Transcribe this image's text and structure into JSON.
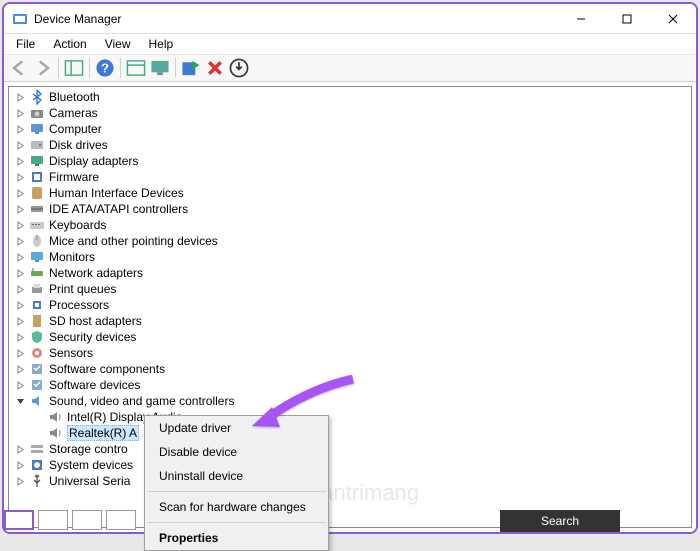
{
  "titlebar": {
    "title": "Device Manager"
  },
  "menubar": {
    "items": [
      "File",
      "Action",
      "View",
      "Help"
    ]
  },
  "toolbar": {
    "icons": [
      "back",
      "forward",
      "sep",
      "show-hide",
      "sep",
      "help",
      "sep",
      "columns",
      "monitor-check",
      "sep",
      "scan",
      "red-x",
      "circle-arrow"
    ]
  },
  "tree": {
    "items": [
      {
        "label": "Bluetooth",
        "level": 0,
        "expand": "right",
        "icon": "bluetooth"
      },
      {
        "label": "Cameras",
        "level": 0,
        "expand": "right",
        "icon": "camera"
      },
      {
        "label": "Computer",
        "level": 0,
        "expand": "right",
        "icon": "computer"
      },
      {
        "label": "Disk drives",
        "level": 0,
        "expand": "right",
        "icon": "disk"
      },
      {
        "label": "Display adapters",
        "level": 0,
        "expand": "right",
        "icon": "display"
      },
      {
        "label": "Firmware",
        "level": 0,
        "expand": "right",
        "icon": "firmware"
      },
      {
        "label": "Human Interface Devices",
        "level": 0,
        "expand": "right",
        "icon": "hid"
      },
      {
        "label": "IDE ATA/ATAPI controllers",
        "level": 0,
        "expand": "right",
        "icon": "ide"
      },
      {
        "label": "Keyboards",
        "level": 0,
        "expand": "right",
        "icon": "keyboard"
      },
      {
        "label": "Mice and other pointing devices",
        "level": 0,
        "expand": "right",
        "icon": "mouse"
      },
      {
        "label": "Monitors",
        "level": 0,
        "expand": "right",
        "icon": "monitor"
      },
      {
        "label": "Network adapters",
        "level": 0,
        "expand": "right",
        "icon": "network"
      },
      {
        "label": "Print queues",
        "level": 0,
        "expand": "right",
        "icon": "print"
      },
      {
        "label": "Processors",
        "level": 0,
        "expand": "right",
        "icon": "cpu"
      },
      {
        "label": "SD host adapters",
        "level": 0,
        "expand": "right",
        "icon": "sd"
      },
      {
        "label": "Security devices",
        "level": 0,
        "expand": "right",
        "icon": "security"
      },
      {
        "label": "Sensors",
        "level": 0,
        "expand": "right",
        "icon": "sensor"
      },
      {
        "label": "Software components",
        "level": 0,
        "expand": "right",
        "icon": "software"
      },
      {
        "label": "Software devices",
        "level": 0,
        "expand": "right",
        "icon": "software"
      },
      {
        "label": "Sound, video and game controllers",
        "level": 0,
        "expand": "down",
        "icon": "sound"
      },
      {
        "label": "Intel(R) Display Audio",
        "level": 1,
        "expand": "none",
        "icon": "audio"
      },
      {
        "label": "Realtek(R) A",
        "level": 1,
        "expand": "none",
        "icon": "audio",
        "selected": true
      },
      {
        "label": "Storage contro",
        "level": 0,
        "expand": "right",
        "icon": "storage"
      },
      {
        "label": "System devices",
        "level": 0,
        "expand": "right",
        "icon": "system"
      },
      {
        "label": "Universal Seria",
        "level": 0,
        "expand": "right",
        "icon": "usb"
      }
    ]
  },
  "context_menu": {
    "items": [
      {
        "label": "Update driver",
        "type": "item"
      },
      {
        "label": "Disable device",
        "type": "item"
      },
      {
        "label": "Uninstall device",
        "type": "item"
      },
      {
        "type": "sep"
      },
      {
        "label": "Scan for hardware changes",
        "type": "item"
      },
      {
        "type": "sep"
      },
      {
        "label": "Properties",
        "type": "item",
        "bold": true
      }
    ]
  },
  "search": {
    "label": "Search"
  },
  "watermark": {
    "text": "uantrimang"
  },
  "annotation": {
    "arrow_color": "#a855f7"
  }
}
